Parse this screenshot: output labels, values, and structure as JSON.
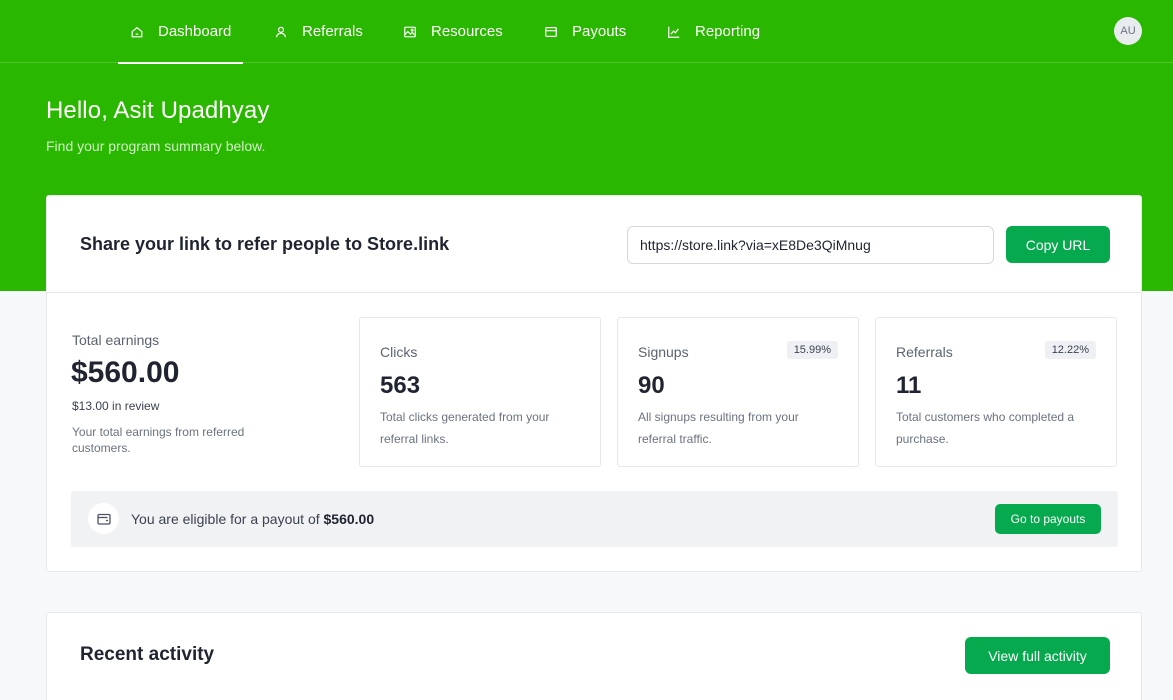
{
  "nav": {
    "items": [
      {
        "label": "Dashboard",
        "icon": "home-icon",
        "active": true
      },
      {
        "label": "Referrals",
        "icon": "user-icon",
        "active": false
      },
      {
        "label": "Resources",
        "icon": "image-icon",
        "active": false
      },
      {
        "label": "Payouts",
        "icon": "wallet-icon",
        "active": false
      },
      {
        "label": "Reporting",
        "icon": "chart-line-icon",
        "active": false
      }
    ],
    "avatar_initials": "AU"
  },
  "header": {
    "greeting": "Hello, Asit Upadhyay",
    "subtitle": "Find your program summary below."
  },
  "share": {
    "title": "Share your link to refer people to Store.link",
    "url": "https://store.link?via=xE8De3QiMnug",
    "copy_label": "Copy URL"
  },
  "earnings": {
    "label": "Total earnings",
    "value": "$560.00",
    "review": "$13.00 in review",
    "description": "Your total earnings from referred customers."
  },
  "stats": [
    {
      "label": "Clicks",
      "value": "563",
      "badge": "",
      "description": "Total clicks generated from your referral links."
    },
    {
      "label": "Signups",
      "value": "90",
      "badge": "15.99%",
      "description": "All signups resulting from your referral traffic."
    },
    {
      "label": "Referrals",
      "value": "11",
      "badge": "12.22%",
      "description": "Total customers who completed a purchase."
    }
  ],
  "payout": {
    "text": "You are eligible for a payout of",
    "amount": "$560.00",
    "button_label": "Go to payouts"
  },
  "activity": {
    "title": "Recent activity",
    "button_label": "View full activity"
  },
  "colors": {
    "brand_green": "#29b700",
    "button_green": "#06a94d"
  }
}
